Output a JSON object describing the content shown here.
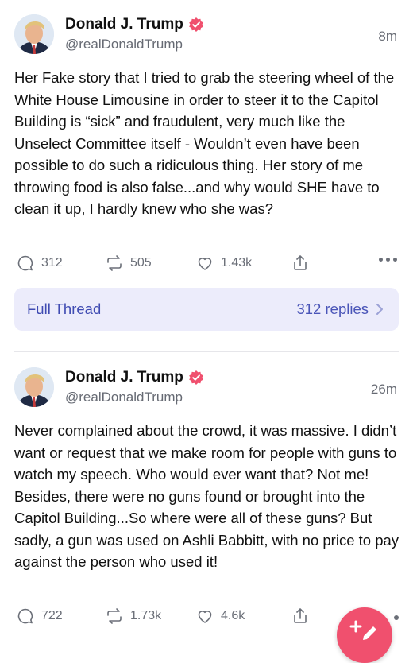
{
  "posts": [
    {
      "author_name": "Donald J. Trump",
      "handle": "@realDonaldTrump",
      "time": "8m",
      "text": "Her Fake story that I tried to grab the steering wheel of the White House Limousine in order to steer it to the Capitol Building is “sick” and fraudulent, very much like the Unselect Committee itself - Wouldn’t even have been possible to do such a ridiculous thing. Her story of me throwing food is also false...and why would SHE have to clean it up, I hardly knew who she was?",
      "replies": "312",
      "reposts": "505",
      "likes": "1.43k",
      "thread_label": "Full Thread",
      "thread_replies": "312 replies"
    },
    {
      "author_name": "Donald J. Trump",
      "handle": "@realDonaldTrump",
      "time": "26m",
      "text": "Never complained about the crowd, it was massive. I didn’t want or request that we make room for people with guns to watch my speech. Who would ever want that? Not me! Besides, there were no guns found or brought into the Capitol Building...So where were all of these guns? But sadly, a gun was used on Ashli Babbitt, with no price to pay against the person who used it!",
      "replies": "722",
      "reposts": "1.73k",
      "likes": "4.6k"
    }
  ],
  "colors": {
    "verified": "#f0506e",
    "thread_bg": "#ececfb",
    "thread_text": "#3f4bb2",
    "muted": "#6b6f78",
    "fab": "#f0506e"
  },
  "icons": [
    "verified-badge-icon",
    "reply-icon",
    "repost-icon",
    "like-icon",
    "share-icon",
    "more-icon",
    "chevron-right-icon",
    "compose-icon"
  ]
}
